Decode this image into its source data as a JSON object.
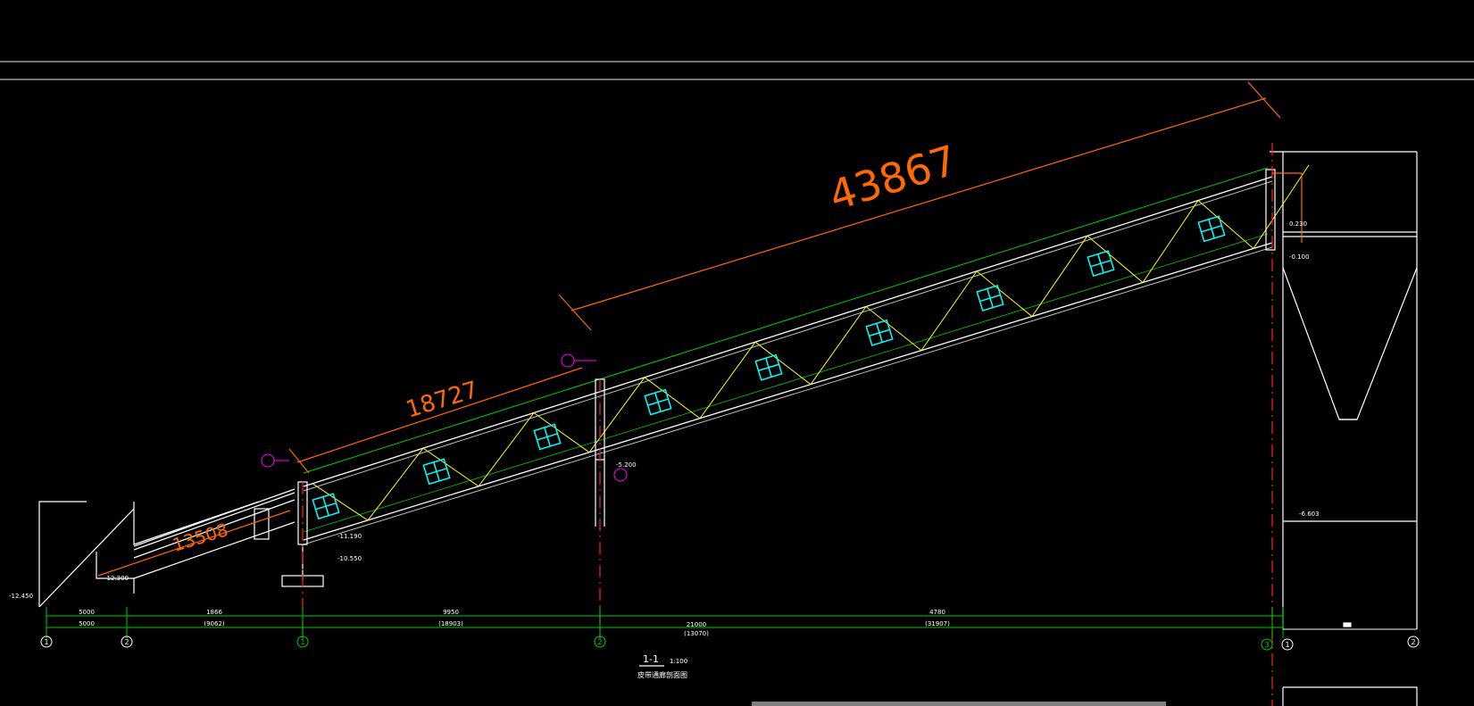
{
  "drawing": {
    "background": "#000000",
    "dimensions": {
      "total": "43867",
      "upper": "18727",
      "lower": "13508"
    },
    "section_title": "1-1",
    "scale": "1:100",
    "subtitle": "皮带通廊剖面图",
    "levels": {
      "top_right": "0.230",
      "top_right_2": "-0.100",
      "mid_right": "-6.603",
      "pit_left": "-12.450",
      "pit_bottom": "-12.300",
      "support_1": "-11.190",
      "support_1b": "-10.550",
      "support_2": "-5.200"
    },
    "axes": {
      "bottom": [
        "1",
        "2",
        "1",
        "2",
        "3",
        "1",
        "2"
      ],
      "segments_row1": [
        "5000",
        "1866",
        "9950",
        "4780"
      ],
      "segments_row2": [
        "5000",
        "(9062)",
        "(18903)",
        "(31907)"
      ],
      "segment_mid": "21000",
      "segment_mid_sub": "(13070)"
    },
    "colors": {
      "structure": "#ffffff",
      "truss_top": "#00cc00",
      "diagonals": "#ffff00",
      "windows": "#00ffff",
      "dimension": "#ff6a00",
      "axis_line": "#ff2020",
      "callout": "#ff00ff"
    }
  }
}
